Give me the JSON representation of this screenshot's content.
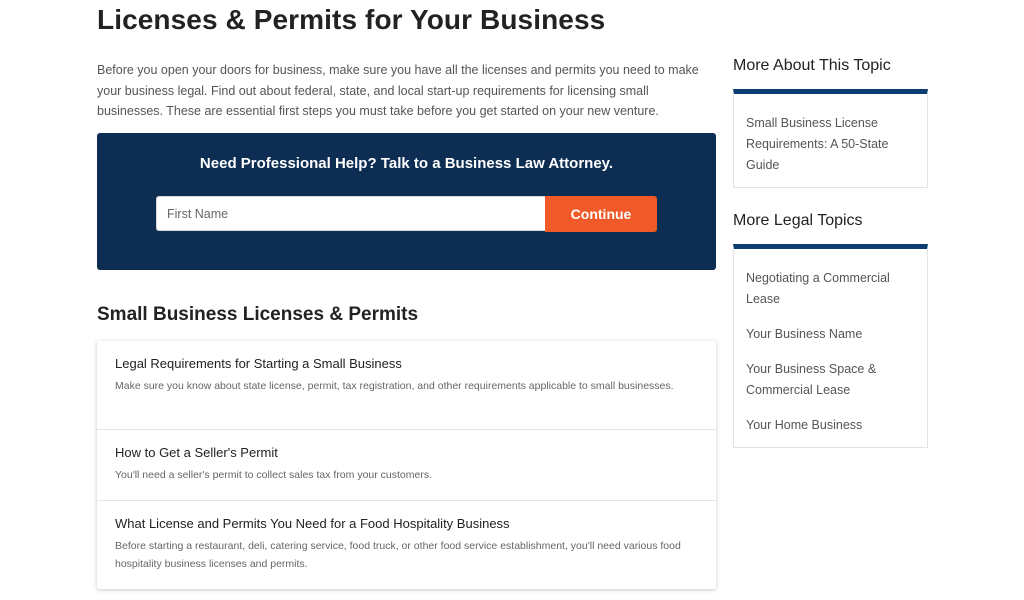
{
  "page": {
    "title": "Licenses & Permits for Your Business",
    "intro": "Before you open your doors for business, make sure you have all the licenses and permits you need to make your business legal. Find out about federal, state, and local start-up requirements for licensing small businesses. These are essential first steps you must take before you get started on your new venture."
  },
  "cta": {
    "heading": "Need Professional Help? Talk to a Business Law Attorney.",
    "input_placeholder": "First Name",
    "button_label": "Continue"
  },
  "section": {
    "title": "Small Business Licenses & Permits",
    "cards": [
      {
        "title": "Legal Requirements for Starting a Small Business",
        "desc": "Make sure you know about state license, permit, tax registration, and other requirements applicable to small businesses."
      },
      {
        "title": "How to Get a Seller's Permit",
        "desc": "You'll need a seller's permit to collect sales tax from your customers."
      },
      {
        "title": "What License and Permits You Need for a Food Hospitality Business",
        "desc": "Before starting a restaurant, deli, catering service, food truck, or other food service establishment, you'll need various food hospitality business licenses and permits."
      }
    ]
  },
  "sidebar": {
    "more_about": {
      "heading": "More About This Topic",
      "links": [
        "Small Business License Requirements: A 50-State Guide"
      ]
    },
    "more_legal": {
      "heading": "More Legal Topics",
      "links": [
        "Negotiating a Commercial Lease",
        "Your Business Name",
        "Your Business Space & Commercial Lease",
        "Your Home Business"
      ]
    }
  },
  "colors": {
    "cta_background": "#0d2d52",
    "cta_button": "#f05a28",
    "sidebar_accent": "#0d3d73"
  }
}
